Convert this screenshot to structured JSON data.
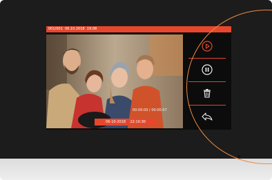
{
  "status_bar": {
    "index": "001/001",
    "date": "06.10.2018",
    "time": "19:08"
  },
  "video": {
    "time_overlay": "00:00:00 / 00:00:07",
    "stamp_date": "06-10-2018",
    "stamp_time": "22:10:30"
  },
  "controls": [
    {
      "name": "play",
      "icon": "play-icon"
    },
    {
      "name": "pause",
      "icon": "pause-icon"
    },
    {
      "name": "delete",
      "icon": "trash-icon"
    },
    {
      "name": "back",
      "icon": "back-arrow-icon"
    }
  ],
  "colors": {
    "accent": "#e6472c",
    "highlight_ring": "#f08a3e",
    "bezel": "#1c1c1c",
    "screen": "#0c0c0c"
  }
}
